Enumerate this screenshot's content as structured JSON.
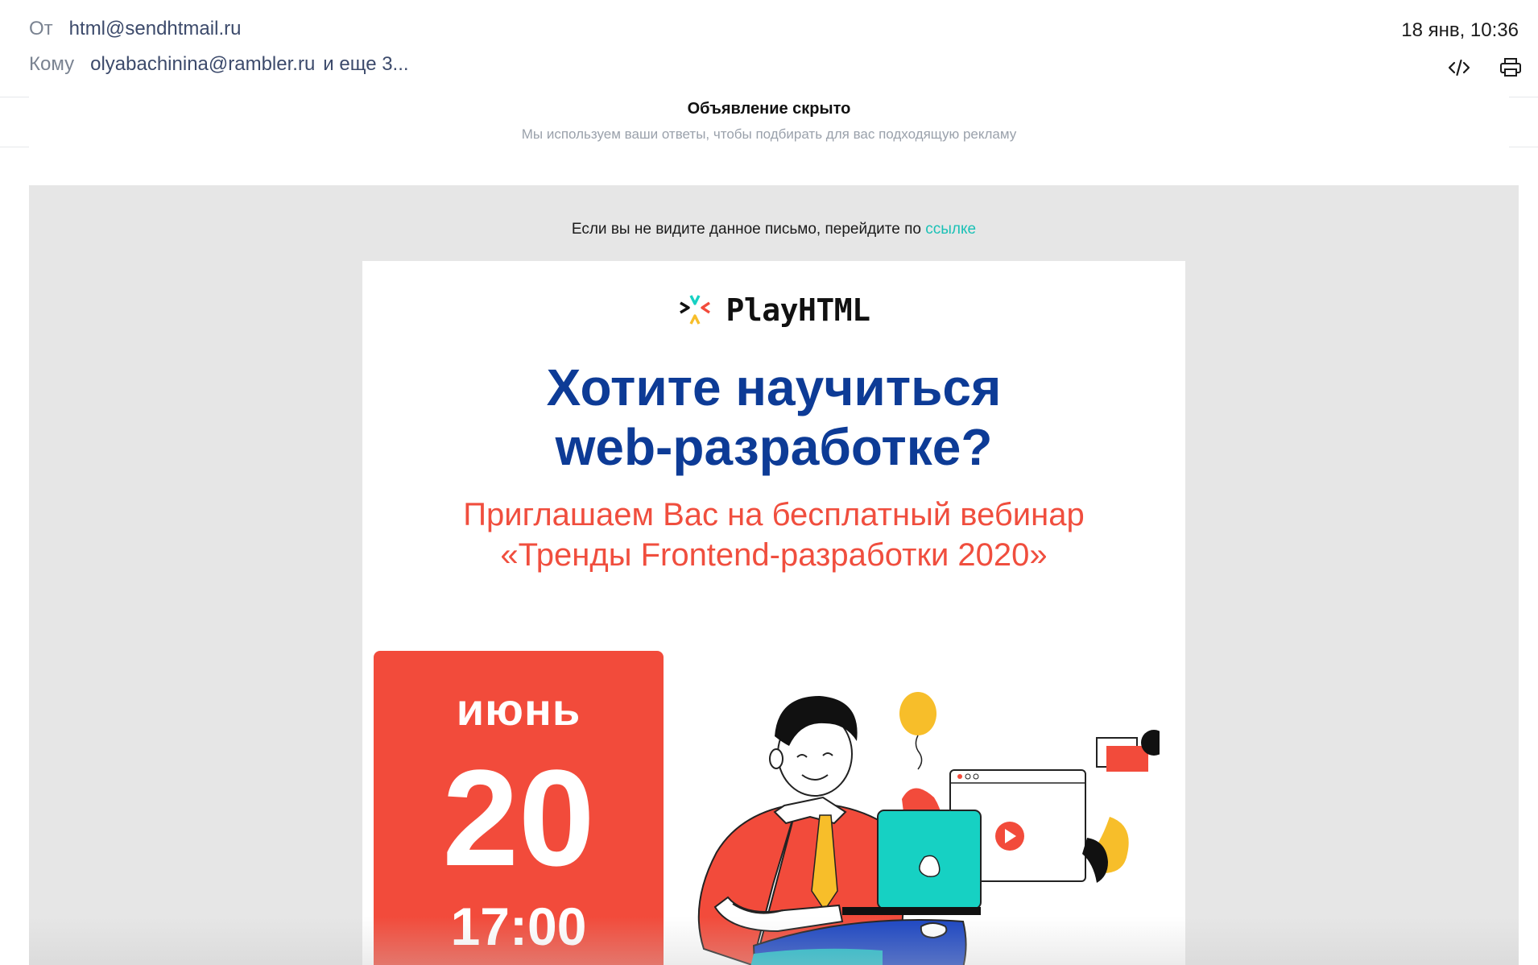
{
  "header": {
    "from_label": "От",
    "from_value": "html@sendhtmail.ru",
    "to_label": "Кому",
    "to_value": "olyabachinina@rambler.ru",
    "to_more": "и еще 3...",
    "date": "18 янв, 10:36",
    "code_icon": "code-icon",
    "print_icon": "print-icon"
  },
  "ad": {
    "title": "Объявление скрыто",
    "subtitle": "Мы используем ваши ответы, чтобы подбирать для вас подходящую рекламу"
  },
  "email": {
    "preheader_text": "Если вы не видите данное письмо, перейдите по ",
    "preheader_link": "ссылке",
    "logo_text": "PlayHTML",
    "headline": "Хотите научиться web-разработке?",
    "subheadline": "Приглашаем Вас на бесплатный вебинар «Тренды Frontend-разработки 2020»",
    "event": {
      "month": "июнь",
      "day": "20",
      "time": "17:00"
    },
    "colors": {
      "brand_blue": "#0d3b96",
      "accent_red": "#f24b3b",
      "link_teal": "#1bc1b6",
      "laptop_teal": "#16d1c3",
      "yellow": "#f7be2a"
    }
  }
}
